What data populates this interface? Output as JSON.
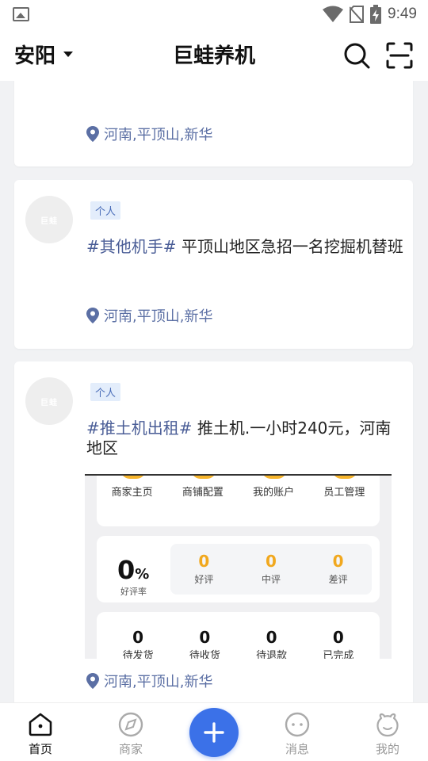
{
  "status_bar": {
    "time": "9:49",
    "icons": [
      "image-icon",
      "wifi-icon",
      "no-sim-icon",
      "battery-charging-icon"
    ]
  },
  "header": {
    "city": "安阳",
    "title": "巨蛙养机",
    "icons": [
      "search-icon",
      "scan-icon"
    ]
  },
  "posts": [
    {
      "location": "河南,平顶山,新华"
    },
    {
      "tag": "个人",
      "topic": "#其他机手#",
      "text": " 平顶山地区急招一名挖掘机替班",
      "location": "河南,平顶山,新华"
    },
    {
      "tag": "个人",
      "topic": "#推土机出租#",
      "text": " 推土机.一小时240元，河南地区",
      "location": "河南,平顶山,新华",
      "image": {
        "menu": [
          "商家主页",
          "商铺配置",
          "我的账户",
          "员工管理"
        ],
        "rate_value": "0",
        "rate_unit": "%",
        "rate_label": "好评率",
        "reviews": [
          {
            "count": "0",
            "label": "好评"
          },
          {
            "count": "0",
            "label": "中评"
          },
          {
            "count": "0",
            "label": "差评"
          }
        ],
        "orders": [
          {
            "count": "0",
            "label": "待发货"
          },
          {
            "count": "0",
            "label": "待收货"
          },
          {
            "count": "0",
            "label": "待退款"
          },
          {
            "count": "0",
            "label": "已完成"
          }
        ]
      }
    }
  ],
  "bottom_nav": {
    "tabs": [
      {
        "label": "首页",
        "icon": "home-icon",
        "active": true
      },
      {
        "label": "商家",
        "icon": "compass-icon",
        "active": false
      },
      {
        "label": "消息",
        "icon": "message-icon",
        "active": false
      },
      {
        "label": "我的",
        "icon": "profile-icon",
        "active": false
      }
    ],
    "fab_icon": "plus-icon"
  },
  "colors": {
    "accent": "#3b71e8",
    "topic": "#4b5e97",
    "location": "#5b6fa4",
    "tag_bg": "#e3edfb"
  }
}
